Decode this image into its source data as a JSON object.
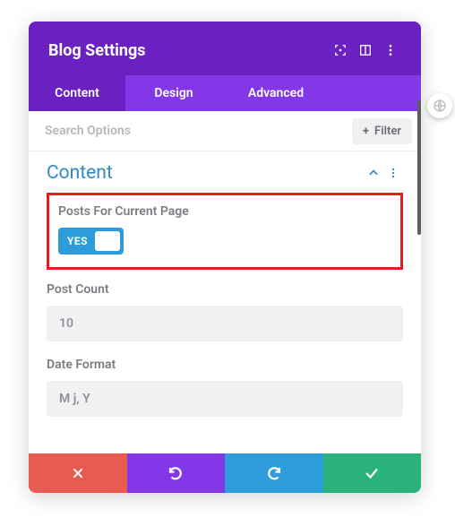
{
  "header": {
    "title": "Blog Settings"
  },
  "tabs": {
    "items": [
      "Content",
      "Design",
      "Advanced"
    ],
    "active": 0
  },
  "search": {
    "placeholder": "Search Options",
    "filter_label": "Filter"
  },
  "section": {
    "title": "Content"
  },
  "fields": {
    "posts_for_current_page": {
      "label": "Posts For Current Page",
      "toggle_text": "YES"
    },
    "post_count": {
      "label": "Post Count",
      "value": "10"
    },
    "date_format": {
      "label": "Date Format",
      "value": "M j, Y"
    }
  }
}
